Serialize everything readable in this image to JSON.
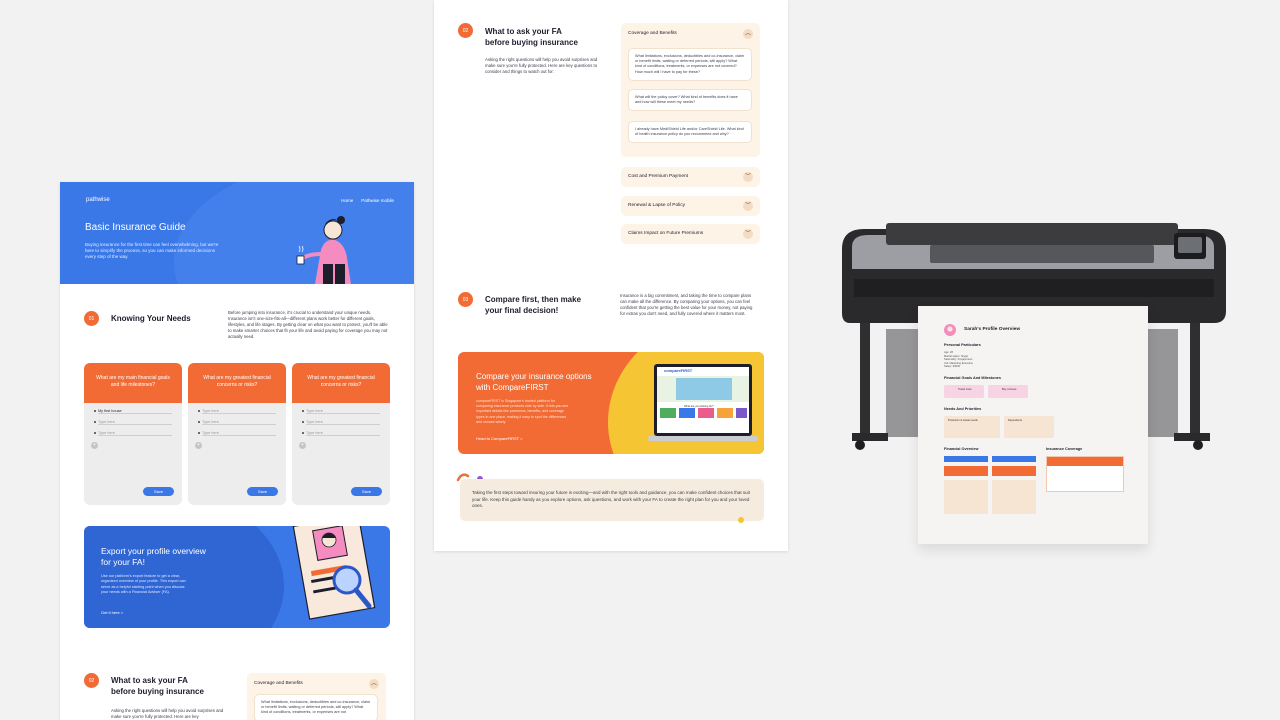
{
  "left_page": {
    "logo": "pathwise",
    "nav": [
      "Home",
      "Pathwise mobile"
    ],
    "hero": {
      "title": "Basic Insurance Guide",
      "subtitle": "Buying insurance for the first time can feel overwhelming, but we're here to simplify the process, so you can make informed decisions every step of the way."
    },
    "section1": {
      "number": "01",
      "title": "Knowing Your Needs",
      "body": "Before jumping into insurance, it's crucial to understand your unique needs. Insurance isn't one-size-fits-all—different plans work better for different goals, lifestyles, and life stages. By getting clear on what you want to protect, you'll be able to make smarter choices that fit your life and avoid paying for coverage you may not actually need."
    },
    "cards": [
      {
        "title": "What are my main financial goals and life milestones?",
        "lines": [
          "My first house",
          "Type here",
          "Type here"
        ],
        "save": "Save"
      },
      {
        "title": "What are my greatest financial concerns or risks?",
        "lines": [
          "Type here",
          "Type here",
          "Type here"
        ],
        "save": "Save"
      },
      {
        "title": "What are my greatest financial concerns or risks?",
        "lines": [
          "Type here",
          "Type here",
          "Type here"
        ],
        "save": "Save"
      }
    ],
    "export": {
      "title": "Export your profile overview for your FA!",
      "body": "Use our platform's export feature to get a clear, organized overview of your profile. This export can serve as a helpful starting point when you discuss your needs with a Financial Adviser (FA).",
      "link": "Get it here >"
    },
    "section2": {
      "number": "02",
      "title_line1": "What to ask your FA",
      "title_line2": "before buying insurance",
      "body": "Asking the right questions will help you avoid surprises and make sure you're fully protected. Here are key"
    },
    "accordion_preview": {
      "title": "Coverage and Benefits",
      "q1": "What limitations, exclusions, deductibles and co-insurance, claim or benefit limits, waiting or deferred periods, will apply? What kind of conditions, treatments, or expenses are not"
    }
  },
  "mid_page": {
    "section2": {
      "number": "02",
      "title_line1": "What to ask your FA",
      "title_line2": "before buying insurance",
      "body": "Asking the right questions will help you avoid surprises and make sure you're fully protected. Here are key questions to consider and things to watch out for:"
    },
    "accordion": {
      "title": "Coverage and Benefits",
      "questions": [
        "What limitations, exclusions, deductibles and co-insurance, claim or benefit limits, waiting or deferred periods, will apply? What kind of conditions, treatments, or expenses are not covered? How much will I have to pay for these?",
        "What will the policy cover? What kind of benefits does it have and how will these meet my needs?",
        "I already have MediShield Life and/or CareShield Life. What kind of health insurance policy do you recommend and why?"
      ],
      "rows": [
        "Cost and Premium Payment",
        "Renewal & Lapse of Policy",
        "Claims Impact on Future Premiums"
      ]
    },
    "section3": {
      "number": "03",
      "title_line1": "Compare first, then make",
      "title_line2": "your final decision!",
      "body": "Insurance is a big commitment, and taking the time to compare plans can make all the difference. By comparing your options, you can feel confident that you're getting the best value for your money, not paying for extras you don't need, and fully covered where it matters most."
    },
    "compare_banner": {
      "title": "Compare your insurance options with CompareFIRST",
      "body": "compareFIRST is Singapore's trusted platform for comparing insurance products side by side. It lets you see important details like premiums, benefits, and coverage types in one place, making it easy to spot the differences and choose wisely.",
      "link": "Head to CompareFIRST >",
      "screen_logo": "compareFIRST",
      "screen_tagline": "What are you looking for?"
    },
    "closing": "Taking the first steps toward insuring your future is exciting—and with the right tools and guidance, you can make confident choices that suit your life. Keep this guide handy as you explore options, ask questions, and work with your FA to create the right plan for you and your loved ones."
  },
  "printout": {
    "title": "Sarah's Profile Overview",
    "personal": "Personal Particulars",
    "personal_lines": [
      "Age: 28",
      "Marital status: Single",
      "Nationality: Singaporean",
      "Job: Marketing Executive",
      "Salary: $4000"
    ],
    "goals": "Financial Goals And Milestones",
    "goal_chips": [
      "Travel more",
      "Buy a house"
    ],
    "needs": "Needs And Priorities",
    "needs_boxes": [
      "Protection & estate needs",
      "Dependents"
    ],
    "financial_overview": "Financial Overview",
    "insurance_coverage": "Insurance Coverage"
  },
  "colors": {
    "blue": "#3a78e8",
    "orange": "#f26b35",
    "yellow": "#f6c533",
    "cream": "#fdf3e6",
    "background": "#f2f2f2"
  }
}
